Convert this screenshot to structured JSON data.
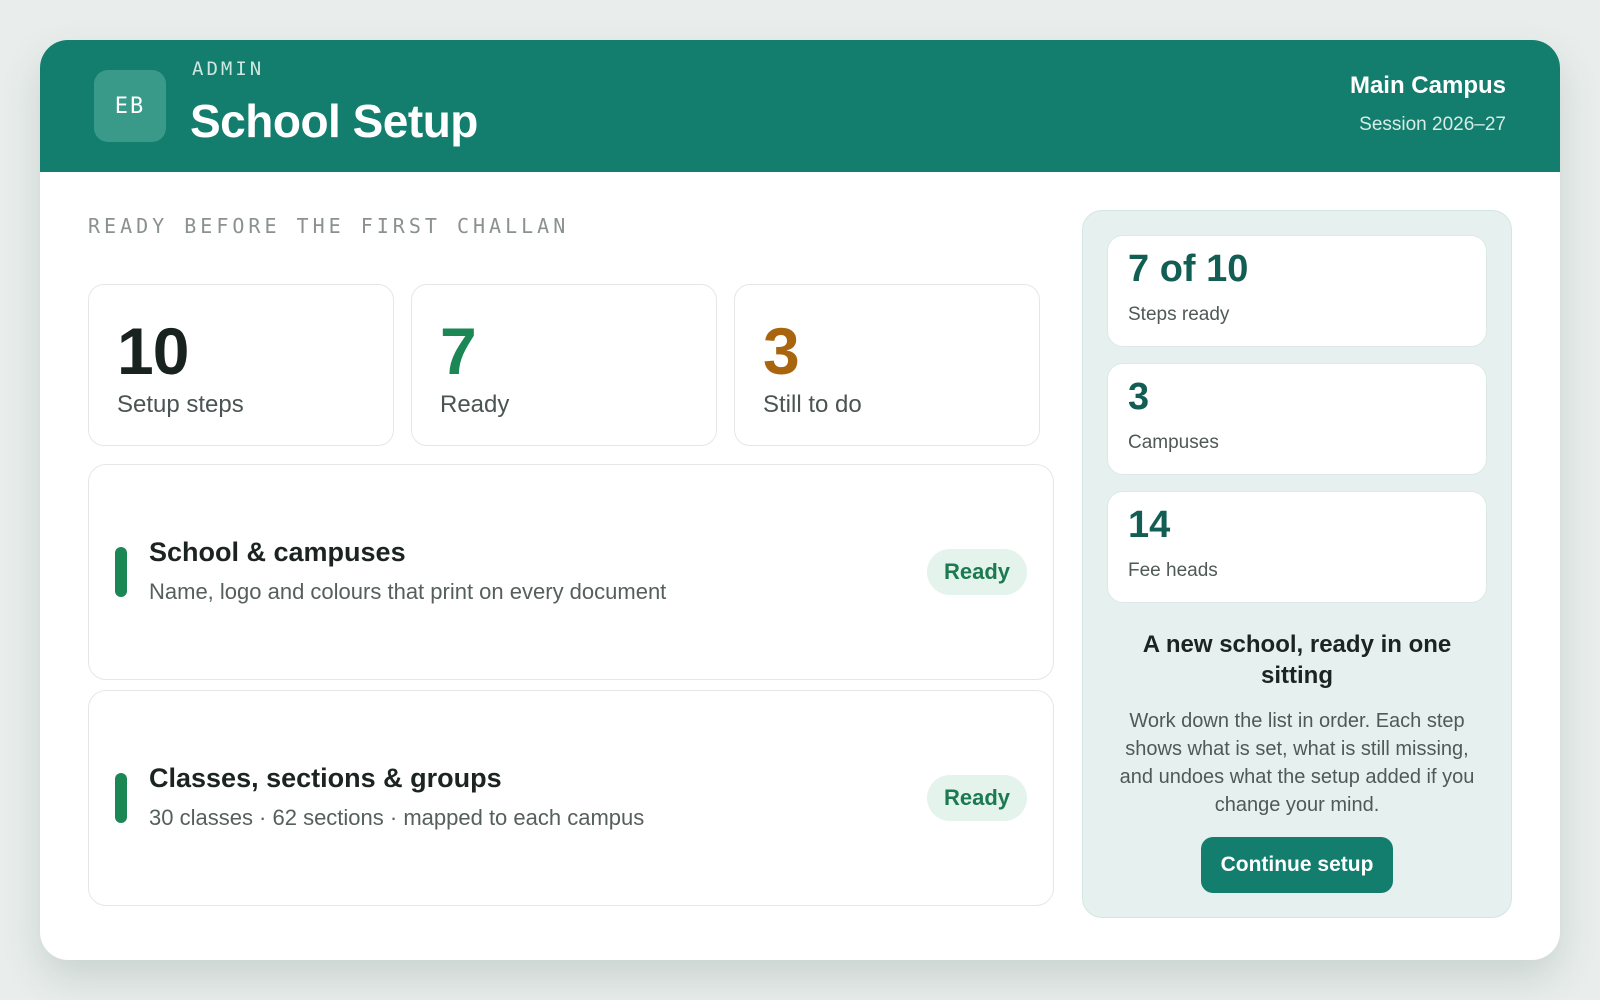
{
  "header": {
    "avatar_initials": "EB",
    "eyebrow": "ADMIN",
    "title": "School Setup",
    "campus": "Main Campus",
    "session": "Session 2026–27"
  },
  "main": {
    "section_label": "READY BEFORE THE FIRST CHALLAN",
    "stats": [
      {
        "value": "10",
        "label": "Setup steps",
        "color": "#18221f"
      },
      {
        "value": "7",
        "label": "Ready",
        "color": "#1b8754"
      },
      {
        "value": "3",
        "label": "Still to do",
        "color": "#a8650e"
      }
    ],
    "tasks": [
      {
        "title": "School & campuses",
        "description": "Name, logo and colours that print on every document",
        "status": "Ready"
      },
      {
        "title": "Classes, sections & groups",
        "description": "30 classes · 62 sections · mapped to each campus",
        "status": "Ready"
      }
    ]
  },
  "sidebar": {
    "metrics": [
      {
        "value": "7 of 10",
        "label": "Steps ready"
      },
      {
        "value": "3",
        "label": "Campuses"
      },
      {
        "value": "14",
        "label": "Fee heads"
      }
    ],
    "heading": "A new school, ready in one sitting",
    "body": "Work down the list in order. Each step shows what is set, what is still missing, and undoes what the setup added if you change your mind.",
    "cta_label": "Continue setup"
  },
  "colors": {
    "brand": "#137e6e",
    "ready_green": "#1b8754",
    "todo_amber": "#a8650e"
  }
}
